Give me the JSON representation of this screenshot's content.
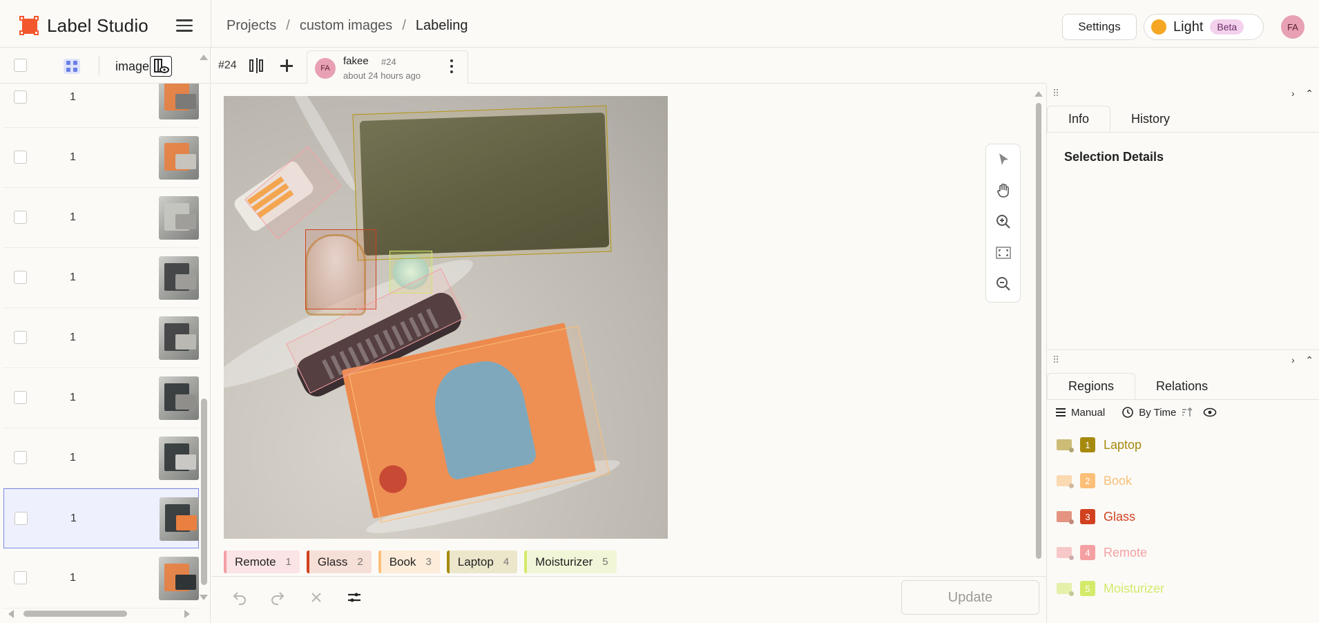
{
  "app": {
    "name": "Label Studio"
  },
  "breadcrumb": {
    "projects": "Projects",
    "project": "custom images",
    "page": "Labeling",
    "sep": "/"
  },
  "header": {
    "settings_label": "Settings",
    "theme_label": "Light",
    "beta_label": "Beta",
    "user_initials": "FA"
  },
  "task_list": {
    "column_label": "image",
    "rows": [
      {
        "value": "1",
        "selected": false
      },
      {
        "value": "1",
        "selected": false
      },
      {
        "value": "1",
        "selected": false
      },
      {
        "value": "1",
        "selected": false
      },
      {
        "value": "1",
        "selected": false
      },
      {
        "value": "1",
        "selected": false
      },
      {
        "value": "1",
        "selected": false
      },
      {
        "value": "1",
        "selected": true
      },
      {
        "value": "1",
        "selected": false
      }
    ]
  },
  "annotation": {
    "task_id": "#24",
    "user": "fakee",
    "ann_id": "#24",
    "time": "about 24 hours ago",
    "initials": "FA"
  },
  "labels": [
    {
      "name": "Remote",
      "key": "1",
      "color": "#f4a0a3",
      "bg": "#fbe4e5"
    },
    {
      "name": "Glass",
      "key": "2",
      "color": "#d2411f",
      "bg": "#f6dfd6"
    },
    {
      "name": "Book",
      "key": "3",
      "color": "#fbbf78",
      "bg": "#fcecd9"
    },
    {
      "name": "Laptop",
      "key": "4",
      "color": "#a68a0e",
      "bg": "#ece6cb"
    },
    {
      "name": "Moisturizer",
      "key": "5",
      "color": "#d4ea6a",
      "bg": "#f1f6d8"
    }
  ],
  "tools": [
    "cursor-icon",
    "hand-icon",
    "zoom-in-icon",
    "fit-icon",
    "zoom-out-icon"
  ],
  "bottom": {
    "update_label": "Update"
  },
  "info_panel": {
    "tab_info": "Info",
    "tab_history": "History",
    "selection_title": "Selection Details"
  },
  "regions_panel": {
    "tab_regions": "Regions",
    "tab_relations": "Relations",
    "manual_label": "Manual",
    "sort_label": "By Time",
    "items": [
      {
        "num": "1",
        "label": "Laptop",
        "color": "#a68a0e"
      },
      {
        "num": "2",
        "label": "Book",
        "color": "#fbbf78"
      },
      {
        "num": "3",
        "label": "Glass",
        "color": "#d2411f"
      },
      {
        "num": "4",
        "label": "Remote",
        "color": "#f4a0a3"
      },
      {
        "num": "5",
        "label": "Moisturizer",
        "color": "#d4ea6a"
      }
    ]
  }
}
